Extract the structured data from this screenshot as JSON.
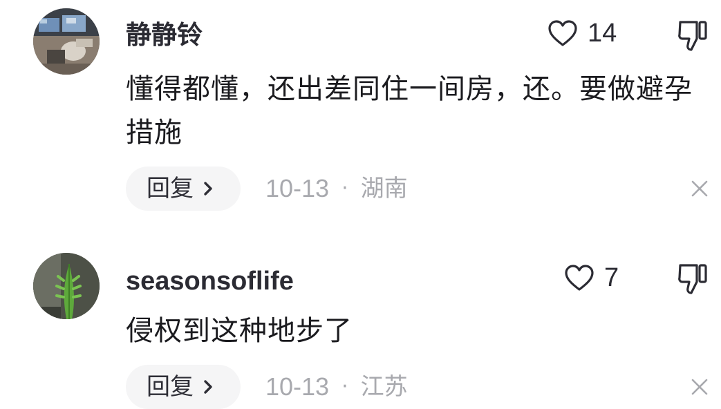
{
  "comments": [
    {
      "username": "静静铃",
      "text": "懂得都懂，还出差同住一间房，还。要做避孕措施",
      "likes": "14",
      "reply_label": "回复",
      "date": "10-13",
      "separator": "·",
      "location": "湖南",
      "icons": {
        "like": "heart-outline-icon",
        "dislike": "thumbs-down-icon",
        "dismiss": "close-icon",
        "reply": "chevron-right-icon"
      }
    },
    {
      "username": "seasonsoflife",
      "text": "侵权到这种地步了",
      "likes": "7",
      "reply_label": "回复",
      "date": "10-13",
      "separator": "·",
      "location": "江苏",
      "icons": {
        "like": "heart-outline-icon",
        "dislike": "thumbs-down-icon",
        "dismiss": "close-icon",
        "reply": "chevron-right-icon"
      }
    }
  ],
  "colors": {
    "text": "#1b1b1f",
    "meta": "#a8a9ae",
    "reply_bg": "#f5f5f6",
    "icon": "#2b2b33"
  }
}
